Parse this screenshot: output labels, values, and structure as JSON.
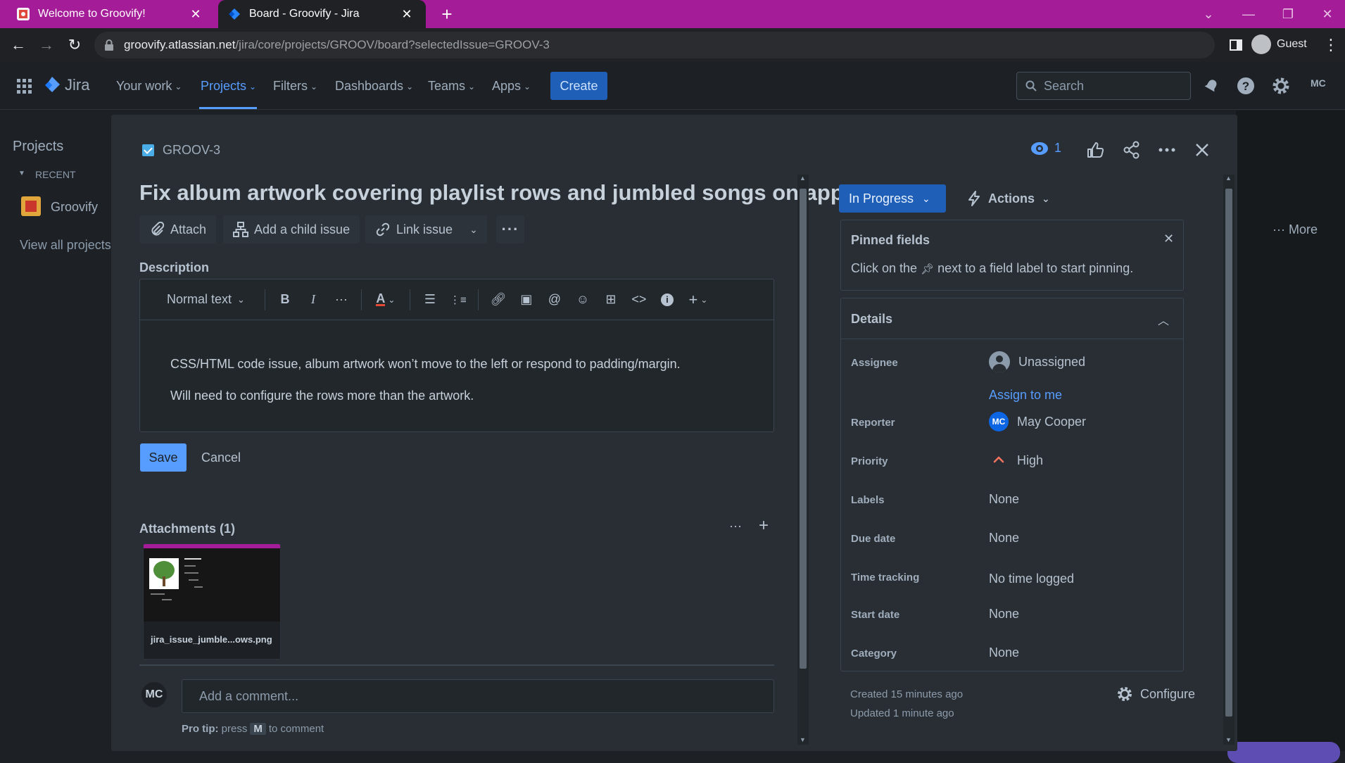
{
  "colors": {
    "tabbar": "#a51c98",
    "jira_bg": "#1d2125",
    "modal_bg": "#282e33",
    "accent_blue": "#579dff",
    "status_blue": "#1f5fb8",
    "priority_high": "#f87462"
  },
  "browser": {
    "tabs": [
      {
        "title": "Welcome to Groovify!",
        "icon": "groovify-favicon"
      },
      {
        "title": "Board - Groovify - Jira",
        "icon": "jira-favicon"
      }
    ],
    "url_host": "groovify.atlassian.net",
    "url_path": "/jira/core/projects/GROOV/board?selectedIssue=GROOV-3",
    "profile": "Guest"
  },
  "jira_nav": {
    "logo": "Jira",
    "items": [
      "Your work",
      "Projects",
      "Filters",
      "Dashboards",
      "Teams",
      "Apps"
    ],
    "create": "Create",
    "search_placeholder": "Search",
    "user_initials": "MC"
  },
  "sidebar": {
    "title": "Projects",
    "recent": "RECENT",
    "project": "Groovify",
    "view_all": "View all projects"
  },
  "background": {
    "more": "··· More"
  },
  "issue": {
    "key": "GROOV-3",
    "watchers": "1",
    "title": "Fix album artwork covering playlist rows and jumbled songs on app",
    "actions": {
      "attach": "Attach",
      "child": "Add a child issue",
      "link": "Link issue"
    },
    "description_label": "Description",
    "editor": {
      "text_style": "Normal text"
    },
    "description": [
      "CSS/HTML code issue, album artwork won’t move to the left or respond to padding/margin.",
      "Will need to configure the rows more than the artwork."
    ],
    "save": "Save",
    "cancel": "Cancel",
    "attachments_label": "Attachments (1)",
    "attachment_name": "jira_issue_jumble...ows.png",
    "comment_initials": "MC",
    "comment_placeholder": "Add a comment...",
    "protip_prefix": "Pro tip:",
    "protip_press": "press",
    "protip_key": "M",
    "protip_suffix": "to comment"
  },
  "panel": {
    "status": "In Progress",
    "actions": "Actions",
    "pinned_title": "Pinned fields",
    "pinned_hint_pre": "Click on the",
    "pinned_hint_post": "next to a field label to start pinning.",
    "details_title": "Details",
    "fields": {
      "assignee": {
        "label": "Assignee",
        "value": "Unassigned",
        "link": "Assign to me"
      },
      "reporter": {
        "label": "Reporter",
        "value": "May Cooper",
        "initials": "MC"
      },
      "priority": {
        "label": "Priority",
        "value": "High"
      },
      "labels": {
        "label": "Labels",
        "value": "None"
      },
      "due": {
        "label": "Due date",
        "value": "None"
      },
      "time": {
        "label": "Time tracking",
        "value": "No time logged"
      },
      "start": {
        "label": "Start date",
        "value": "None"
      },
      "category": {
        "label": "Category",
        "value": "None"
      }
    },
    "created": "Created 15 minutes ago",
    "updated": "Updated 1 minute ago",
    "configure": "Configure"
  }
}
